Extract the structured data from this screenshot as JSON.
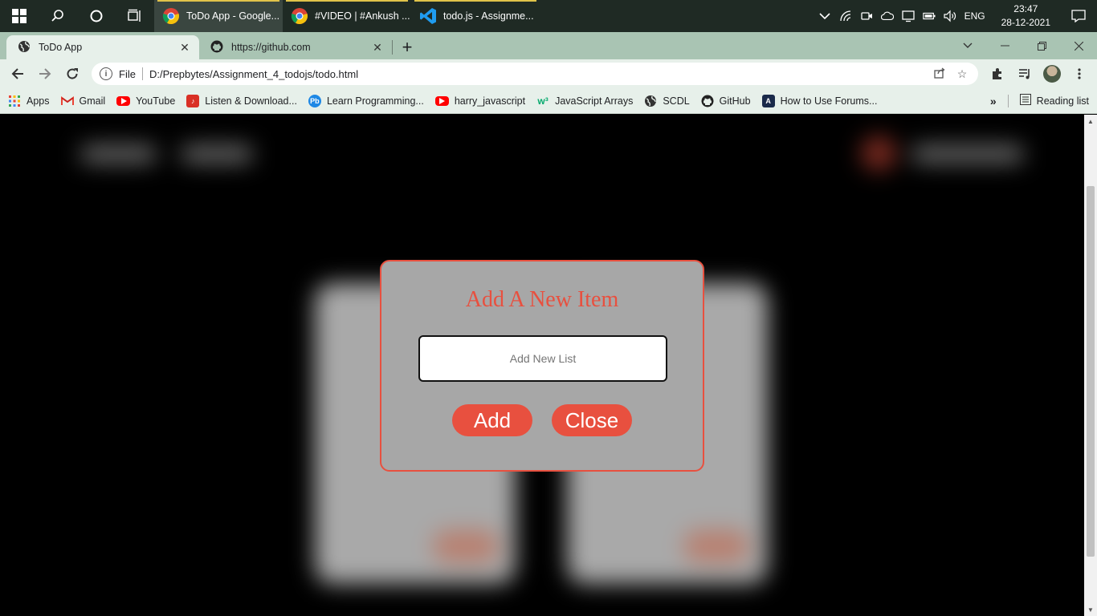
{
  "taskbar": {
    "apps": [
      {
        "label": "ToDo App - Google...",
        "icon": "chrome-icon",
        "active": true
      },
      {
        "label": "#VIDEO | #Ankush ...",
        "icon": "chrome-icon",
        "active": false
      },
      {
        "label": "todo.js - Assignme...",
        "icon": "vscode-icon",
        "active": false
      }
    ],
    "language": "ENG",
    "time": "23:47",
    "date": "28-12-2021"
  },
  "browser": {
    "tabs": [
      {
        "title": "ToDo App",
        "icon": "globe-icon"
      },
      {
        "title": "https://github.com",
        "icon": "github-icon"
      }
    ],
    "address": {
      "scheme_label": "File",
      "url": "D:/Prepbytes/Assignment_4_todojs/todo.html"
    },
    "bookmarks": [
      {
        "label": "Apps",
        "icon": "apps-grid-icon"
      },
      {
        "label": "Gmail",
        "icon": "gmail-icon"
      },
      {
        "label": "YouTube",
        "icon": "youtube-icon"
      },
      {
        "label": "Listen & Download...",
        "icon": "music-icon"
      },
      {
        "label": "Learn Programming...",
        "icon": "pb-icon"
      },
      {
        "label": "harry_javascript",
        "icon": "youtube-icon"
      },
      {
        "label": "JavaScript Arrays",
        "icon": "w3-icon"
      },
      {
        "label": "SCDL",
        "icon": "globe-icon"
      },
      {
        "label": "GitHub",
        "icon": "github-icon"
      },
      {
        "label": "How to Use Forums...",
        "icon": "forum-icon"
      }
    ],
    "reading_list": "Reading list"
  },
  "modal": {
    "title": "Add A New Item",
    "input_placeholder": "Add New List",
    "input_value": "",
    "add_label": "Add",
    "close_label": "Close"
  },
  "colors": {
    "accent": "#e8503f",
    "modal_bg": "#a7a7a7",
    "page_bg": "#000000"
  }
}
